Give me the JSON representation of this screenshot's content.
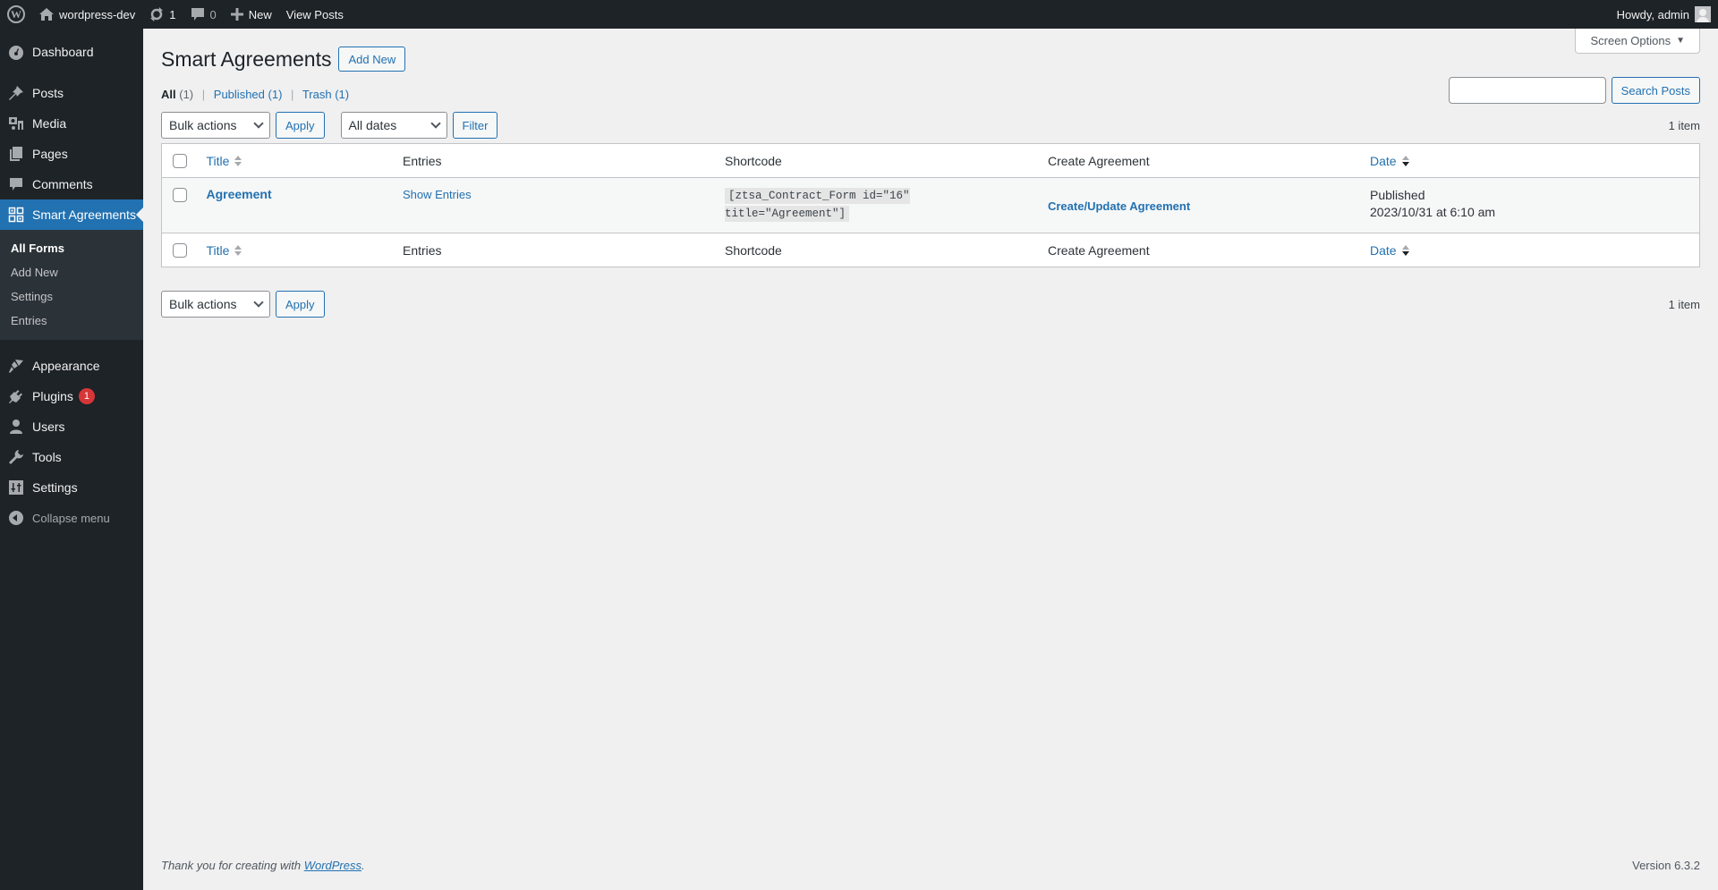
{
  "adminbar": {
    "site_name": "wordpress-dev",
    "updates_count": "1",
    "comments_count": "0",
    "new_label": "New",
    "view_posts_label": "View Posts",
    "howdy": "Howdy, admin"
  },
  "sidebar": {
    "items": [
      {
        "label": "Dashboard",
        "icon": "dashboard-icon"
      },
      {
        "label": "Posts",
        "icon": "pin-icon"
      },
      {
        "label": "Media",
        "icon": "media-icon"
      },
      {
        "label": "Pages",
        "icon": "pages-icon"
      },
      {
        "label": "Comments",
        "icon": "comment-icon"
      },
      {
        "label": "Smart Agreements",
        "icon": "grid-icon",
        "active": true
      },
      {
        "label": "Appearance",
        "icon": "brush-icon"
      },
      {
        "label": "Plugins",
        "icon": "plug-icon",
        "badge": "1"
      },
      {
        "label": "Users",
        "icon": "user-icon"
      },
      {
        "label": "Tools",
        "icon": "wrench-icon"
      },
      {
        "label": "Settings",
        "icon": "sliders-icon"
      }
    ],
    "submenu": [
      {
        "label": "All Forms",
        "current": true
      },
      {
        "label": "Add New"
      },
      {
        "label": "Settings"
      },
      {
        "label": "Entries"
      }
    ],
    "collapse_label": "Collapse menu"
  },
  "screen_options_label": "Screen Options",
  "header": {
    "title": "Smart Agreements",
    "add_new_label": "Add New"
  },
  "views": [
    {
      "label": "All",
      "count": "(1)",
      "current": true
    },
    {
      "label": "Published",
      "count": "(1)"
    },
    {
      "label": "Trash",
      "count": "(1)"
    }
  ],
  "search": {
    "value": "",
    "button_label": "Search Posts"
  },
  "tablenav_top": {
    "bulk_actions": "Bulk actions",
    "apply_label": "Apply",
    "dates_filter": "All dates",
    "filter_label": "Filter",
    "items_count": "1 item"
  },
  "table": {
    "columns": {
      "title": "Title",
      "entries": "Entries",
      "shortcode": "Shortcode",
      "create": "Create Agreement",
      "date": "Date"
    },
    "rows": [
      {
        "title": "Agreement",
        "entries_link": "Show Entries",
        "shortcode": "[ztsa_Contract_Form id=\"16\" title=\"Agreement\"]",
        "create_link": "Create/Update Agreement",
        "status": "Published",
        "date": "2023/10/31 at 6:10 am"
      }
    ]
  },
  "tablenav_bottom": {
    "bulk_actions": "Bulk actions",
    "apply_label": "Apply",
    "items_count": "1 item"
  },
  "footer": {
    "thanks_prefix": "Thank you for creating with ",
    "thanks_link": "WordPress",
    "thanks_suffix": ".",
    "version": "Version 6.3.2"
  },
  "colors": {
    "accent": "#2271b1",
    "adminbar_bg": "#1d2327",
    "badge": "#d63638"
  }
}
